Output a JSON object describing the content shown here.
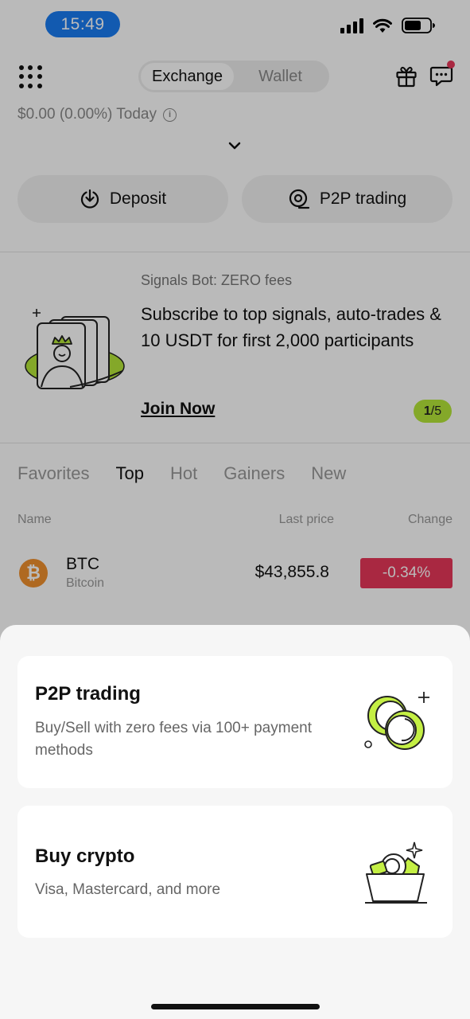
{
  "status_bar": {
    "time": "15:49"
  },
  "header": {
    "tabs": [
      "Exchange",
      "Wallet"
    ],
    "active_tab": "Exchange"
  },
  "balance": {
    "text": "$0.00 (0.00%) Today"
  },
  "actions": {
    "deposit": "Deposit",
    "p2p": "P2P trading"
  },
  "banner": {
    "kicker": "Signals Bot: ZERO fees",
    "title": "Subscribe to top signals, auto-trades & 10 USDT for first 2,000 participants",
    "link": "Join Now",
    "page_current": "1",
    "page_total": "/5"
  },
  "market": {
    "tabs": [
      "Favorites",
      "Top",
      "Hot",
      "Gainers",
      "New"
    ],
    "active_tab": "Top",
    "columns": {
      "name": "Name",
      "last_price": "Last price",
      "change": "Change"
    },
    "rows": [
      {
        "symbol": "BTC",
        "name": "Bitcoin",
        "price": "$43,855.8",
        "change": "-0.34%"
      }
    ]
  },
  "sheet": {
    "options": [
      {
        "title": "P2P trading",
        "description": "Buy/Sell with zero fees via 100+ payment methods",
        "icon": "coins-exchange-icon"
      },
      {
        "title": "Buy crypto",
        "description": "Visa, Mastercard, and more",
        "icon": "wallet-card-icon"
      }
    ]
  },
  "colors": {
    "accent_green": "#b5e639",
    "negative": "#e8375a",
    "time_pill": "#1a7cf2"
  }
}
